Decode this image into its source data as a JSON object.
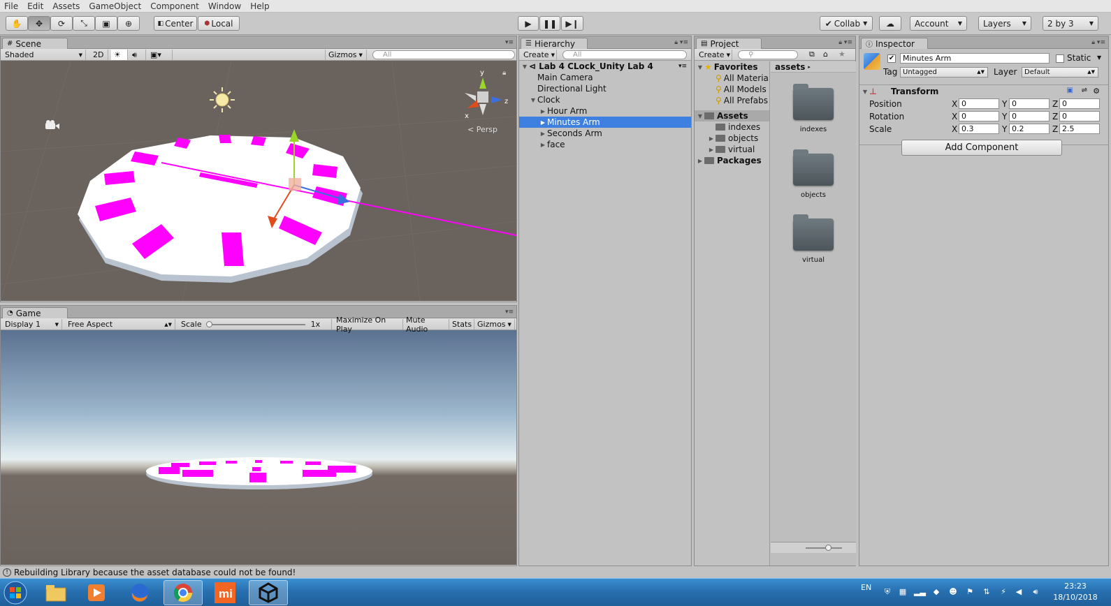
{
  "menu": [
    "File",
    "Edit",
    "Assets",
    "GameObject",
    "Component",
    "Window",
    "Help"
  ],
  "toolbar": {
    "pivot": "Center",
    "space": "Local",
    "collab": "Collab",
    "account": "Account",
    "layers": "Layers",
    "layout": "2 by 3"
  },
  "scene": {
    "tab": "Scene",
    "shading": "Shaded",
    "mode2d": "2D",
    "gizmos": "Gizmos",
    "search_placeholder": "All",
    "persp": "Persp",
    "axis_x": "x",
    "axis_y": "y",
    "axis_z": "z"
  },
  "game": {
    "tab": "Game",
    "display": "Display 1",
    "aspect": "Free Aspect",
    "scale_label": "Scale",
    "scale_value": "1x",
    "maximize": "Maximize On Play",
    "mute": "Mute Audio",
    "stats": "Stats",
    "gizmos": "Gizmos"
  },
  "hierarchy": {
    "tab": "Hierarchy",
    "create": "Create",
    "search_placeholder": "All",
    "scene": "Lab 4 CLock_Unity Lab 4",
    "items": [
      "Main Camera",
      "Directional Light",
      "Clock",
      "Hour Arm",
      "Minutes Arm",
      "Seconds Arm",
      "face"
    ]
  },
  "project": {
    "tab": "Project",
    "create": "Create",
    "favorites": "Favorites",
    "fav_items": [
      "All Materia",
      "All Models",
      "All Prefabs"
    ],
    "assets": "Assets",
    "asset_items": [
      "indexes",
      "objects",
      "virtual"
    ],
    "packages": "Packages",
    "breadcrumb": "assets",
    "folders": [
      "indexes",
      "objects",
      "virtual"
    ]
  },
  "inspector": {
    "tab": "Inspector",
    "name": "Minutes Arm",
    "static": "Static",
    "tag_label": "Tag",
    "tag": "Untagged",
    "layer_label": "Layer",
    "layer": "Default",
    "component": "Transform",
    "position_label": "Position",
    "rotation_label": "Rotation",
    "scale_label": "Scale",
    "position": {
      "x": "0",
      "y": "0",
      "z": "0"
    },
    "rotation": {
      "x": "0",
      "y": "0",
      "z": "0"
    },
    "scale": {
      "x": "0.3",
      "y": "0.2",
      "z": "2.5"
    },
    "add_component": "Add Component",
    "x": "X",
    "y": "Y",
    "z": "Z"
  },
  "status": "Rebuilding Library because the asset database could not be found!",
  "taskbar": {
    "lang": "EN",
    "time": "23:23",
    "date": "18/10/2018"
  },
  "colors": {
    "accent": "#3d80df",
    "marker": "#ff00ff",
    "scene_bg": "#6a625c"
  }
}
